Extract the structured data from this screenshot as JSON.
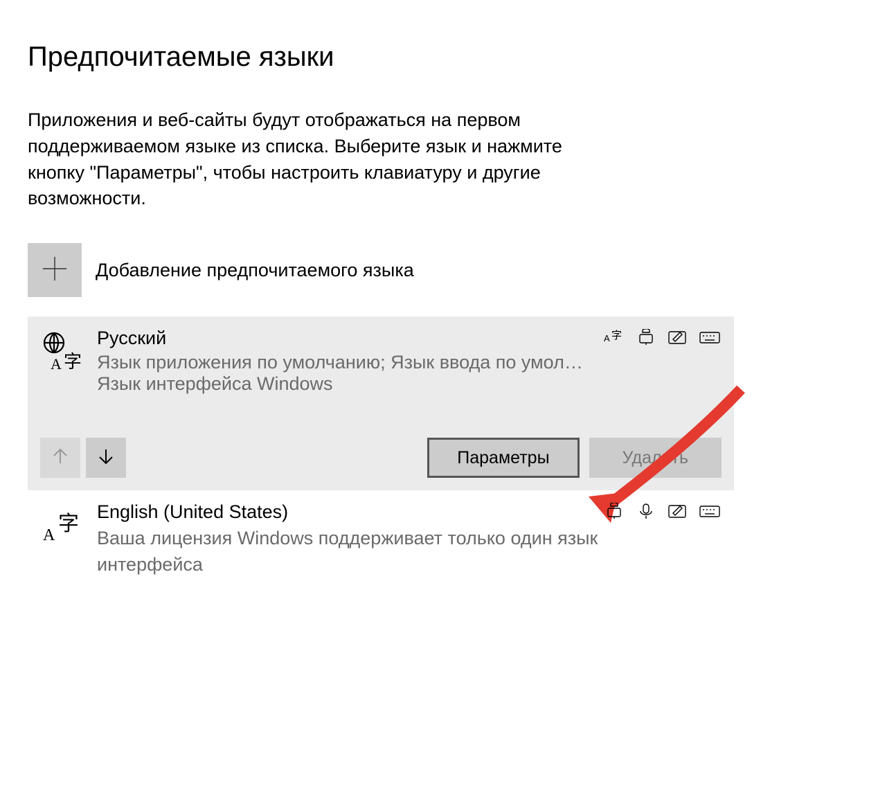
{
  "heading": "Предпочитаемые языки",
  "description": "Приложения и веб-сайты будут отображаться на первом поддерживаемом языке из списка. Выберите язык и нажмите кнопку \"Параметры\", чтобы настроить клавиатуру и другие возможности.",
  "add_language_label": "Добавление предпочитаемого языка",
  "languages": [
    {
      "name": "Русский",
      "meta1": "Язык приложения по умолчанию; Язык ввода по умол…",
      "meta2": "Язык интерфейса Windows",
      "feature_icons": [
        "display-language",
        "text-to-speech",
        "handwriting",
        "keyboard"
      ]
    },
    {
      "name": "English (United States)",
      "meta": "Ваша лицензия Windows поддерживает только один язык интерфейса",
      "feature_icons": [
        "text-to-speech",
        "speech-recognition",
        "handwriting",
        "keyboard"
      ]
    }
  ],
  "buttons": {
    "options": "Параметры",
    "delete": "Удалить"
  }
}
